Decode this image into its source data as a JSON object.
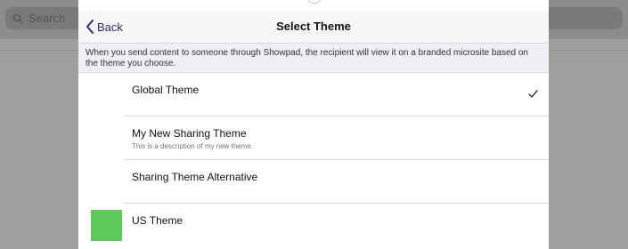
{
  "background": {
    "search_placeholder": "Search"
  },
  "modal": {
    "back_label": "Back",
    "title": "Select Theme",
    "description": "When you send content to someone through Showpad, the recipient will view it on a branded microsite based on the theme you choose.",
    "themes": [
      {
        "title": "Global Theme",
        "subtitle": "",
        "selected": true
      },
      {
        "title": "My New Sharing Theme",
        "subtitle": "This is a description of my new theme.",
        "selected": false
      },
      {
        "title": "Sharing Theme Alternative",
        "subtitle": "",
        "selected": false
      },
      {
        "title": "US Theme",
        "subtitle": "",
        "selected": false,
        "swatch_color": "#5ec85a"
      }
    ]
  },
  "colors": {
    "accent": "#2f2d6b",
    "swatch": "#5ec85a"
  }
}
